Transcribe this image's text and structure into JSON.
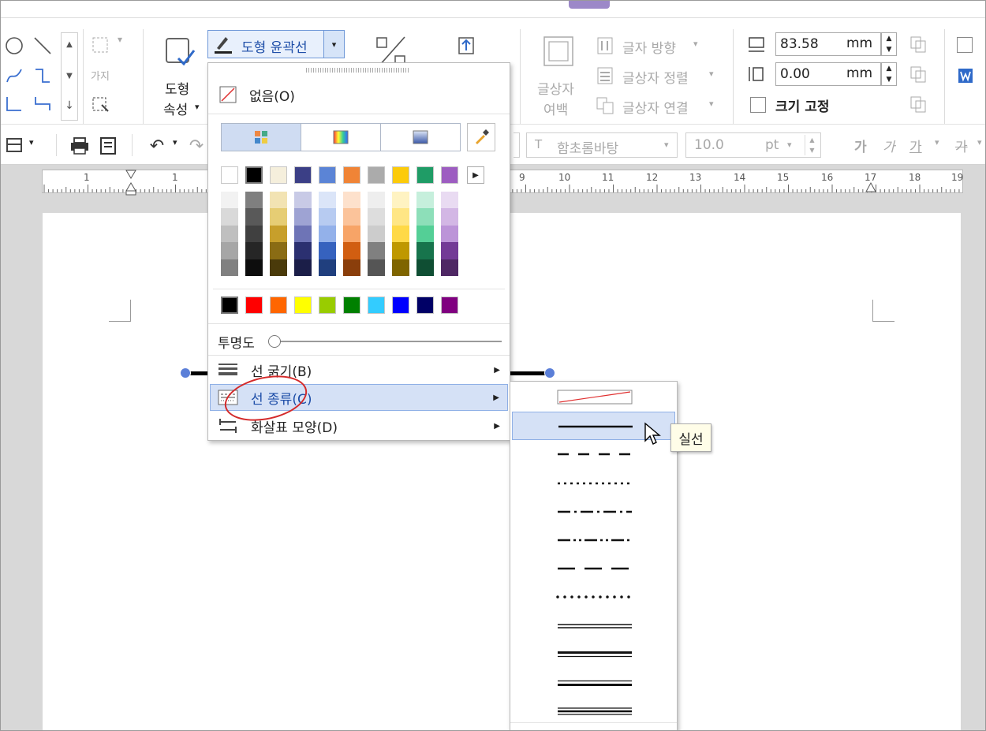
{
  "ribbon": {
    "shape_properties_line1": "도형",
    "shape_properties_line2": "속성",
    "shape_outline_label": "도형 윤곽선",
    "textbox_margin_line1": "글상자",
    "textbox_margin_line2": "여백",
    "text_direction": "글자 방향",
    "text_align": "글상자 정렬",
    "text_link": "글상자 연결",
    "width_value": "83.58",
    "height_value": "0.00",
    "unit": "mm",
    "size_lock_label": "크기 고정",
    "chart_glyph": "가지"
  },
  "toolbar2": {
    "font_name": "함초롬바탕",
    "font_size": "10.0",
    "font_unit": "pt",
    "fmt_bold": "가",
    "fmt_italic": "가",
    "fmt_underline": "가",
    "fmt_strike": "가"
  },
  "ruler": {
    "numbers_left": [
      "1",
      "1"
    ],
    "numbers_right": [
      "9",
      "10",
      "11",
      "12",
      "13",
      "14",
      "15",
      "16",
      "17",
      "18",
      "19"
    ]
  },
  "color_menu": {
    "none_label": "없음(O)",
    "transparency_label": "투명도",
    "transparency_value": 0,
    "line_thickness_label": "선 굵기(B)",
    "line_type_label": "선 종류(C)",
    "arrow_shape_label": "화살표 모양(D)",
    "top_colors": [
      "#ffffff",
      "#000000",
      "#f5efdc",
      "#3b3f86",
      "#5b84d6",
      "#f08436",
      "#ababab",
      "#fccb0a",
      "#1f9c66",
      "#9d5dc1"
    ],
    "shade_columns": [
      [
        "#f2f2f2",
        "#d9d9d9",
        "#bfbfbf",
        "#a6a6a6",
        "#808080"
      ],
      [
        "#7f7f7f",
        "#595959",
        "#404040",
        "#262626",
        "#0d0d0d"
      ],
      [
        "#f2e3b3",
        "#e6cd74",
        "#c79f2b",
        "#8a6c14",
        "#4a3a0a"
      ],
      [
        "#c8cae6",
        "#9ea3d3",
        "#6e74b6",
        "#2b3070",
        "#1b1e48"
      ],
      [
        "#dbe5f8",
        "#b7cbf1",
        "#93b1ea",
        "#3662be",
        "#203f7e"
      ],
      [
        "#fde1cc",
        "#fbc39a",
        "#f7a467",
        "#d15e11",
        "#8a3e0b"
      ],
      [
        "#eeeeee",
        "#dddddd",
        "#cccccc",
        "#808080",
        "#555555"
      ],
      [
        "#fff3c2",
        "#ffe685",
        "#ffd947",
        "#bf9800",
        "#7f6500"
      ],
      [
        "#c6efdc",
        "#8ddfb9",
        "#54cf96",
        "#17744c",
        "#0f4e33"
      ],
      [
        "#e9dbf2",
        "#d3b7e5",
        "#bc94d8",
        "#733a96",
        "#4e2764"
      ]
    ],
    "standard_colors": [
      "#000000",
      "#ff0000",
      "#ff6600",
      "#ffff00",
      "#99cc00",
      "#008000",
      "#33ccff",
      "#0000ff",
      "#000066",
      "#800080"
    ]
  },
  "line_menu": {
    "tooltip": "실선",
    "styles": [
      "none",
      "solid",
      "dash",
      "dot",
      "dash-dot",
      "dash-dot-dot",
      "long-dash",
      "round-dot",
      "double",
      "thick-thin",
      "thin-thick",
      "triple"
    ],
    "selected_index": 1
  }
}
